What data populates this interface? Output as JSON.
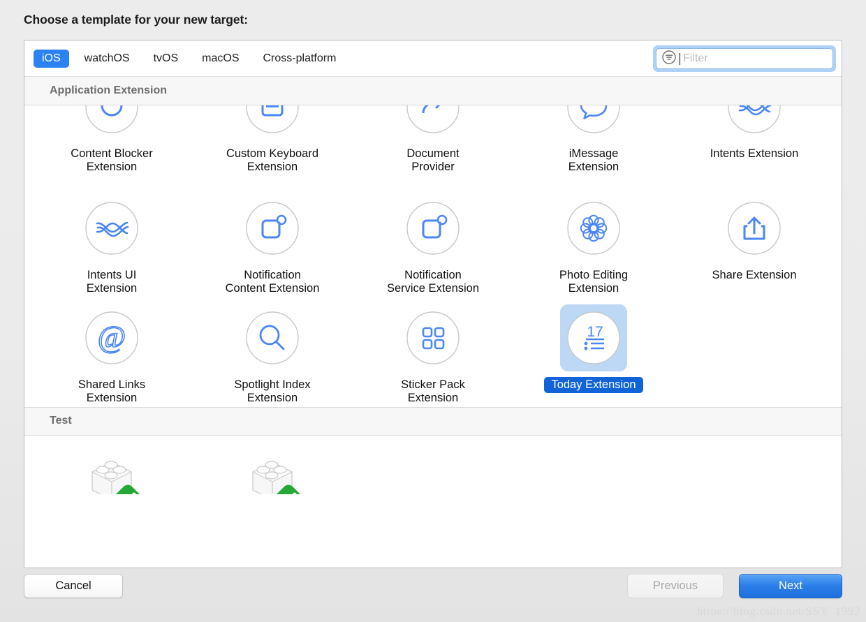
{
  "dialog": {
    "title": "Choose a template for your new target:"
  },
  "colors": {
    "accent_blue": "#2b82f0",
    "selected_label_blue": "#1064d8",
    "selection_fill": "#bcd8f5",
    "icon_blue": "#4a86f7",
    "icon_ring": "#c8c8c8",
    "section_header_text": "#6e6e6e",
    "check_green": "#27a737"
  },
  "tabs": [
    {
      "label": "iOS",
      "selected": true
    },
    {
      "label": "watchOS",
      "selected": false
    },
    {
      "label": "tvOS",
      "selected": false
    },
    {
      "label": "macOS",
      "selected": false
    },
    {
      "label": "Cross-platform",
      "selected": false
    }
  ],
  "filter": {
    "icon": "filter-icon",
    "value": "",
    "placeholder": "Filter",
    "focused": true
  },
  "sections": [
    {
      "header": "Application Extension",
      "rows": [
        {
          "clipped": true,
          "tiles": [
            {
              "label": "Content Blocker\nExtension",
              "icon": "content-blocker-icon",
              "selected": false
            },
            {
              "label": "Custom Keyboard\nExtension",
              "icon": "custom-keyboard-icon",
              "selected": false
            },
            {
              "label": "Document\nProvider",
              "icon": "document-provider-icon",
              "selected": false
            },
            {
              "label": "iMessage\nExtension",
              "icon": "imessage-icon",
              "selected": false
            },
            {
              "label": "Intents Extension",
              "icon": "intents-icon",
              "selected": false
            }
          ]
        },
        {
          "clipped": false,
          "tiles": [
            {
              "label": "Intents UI\nExtension",
              "icon": "intents-ui-icon",
              "selected": false
            },
            {
              "label": "Notification\nContent Extension",
              "icon": "notification-content-icon",
              "selected": false
            },
            {
              "label": "Notification\nService Extension",
              "icon": "notification-service-icon",
              "selected": false
            },
            {
              "label": "Photo Editing\nExtension",
              "icon": "photo-editing-icon",
              "selected": false
            },
            {
              "label": "Share Extension",
              "icon": "share-icon",
              "selected": false
            }
          ]
        },
        {
          "clipped": false,
          "tiles": [
            {
              "label": "Shared Links\nExtension",
              "icon": "shared-links-icon",
              "selected": false
            },
            {
              "label": "Spotlight Index\nExtension",
              "icon": "spotlight-index-icon",
              "selected": false
            },
            {
              "label": "Sticker Pack\nExtension",
              "icon": "sticker-pack-icon",
              "selected": false
            },
            {
              "label": "Today Extension",
              "icon": "today-extension-icon",
              "selected": true
            },
            {
              "label": "",
              "icon": "",
              "selected": false
            }
          ]
        }
      ]
    },
    {
      "header": "Test",
      "rows": [
        {
          "clipped": true,
          "tiles": [
            {
              "label": "",
              "icon": "test-bundle-icon",
              "selected": false
            },
            {
              "label": "",
              "icon": "test-bundle-icon",
              "selected": false
            },
            {
              "label": "",
              "icon": "",
              "selected": false
            },
            {
              "label": "",
              "icon": "",
              "selected": false
            },
            {
              "label": "",
              "icon": "",
              "selected": false
            }
          ]
        }
      ]
    }
  ],
  "footer": {
    "cancel_label": "Cancel",
    "previous_label": "Previous",
    "previous_disabled": true,
    "next_label": "Next"
  },
  "watermark": "https://blog.csdn.net/SSY_1992"
}
